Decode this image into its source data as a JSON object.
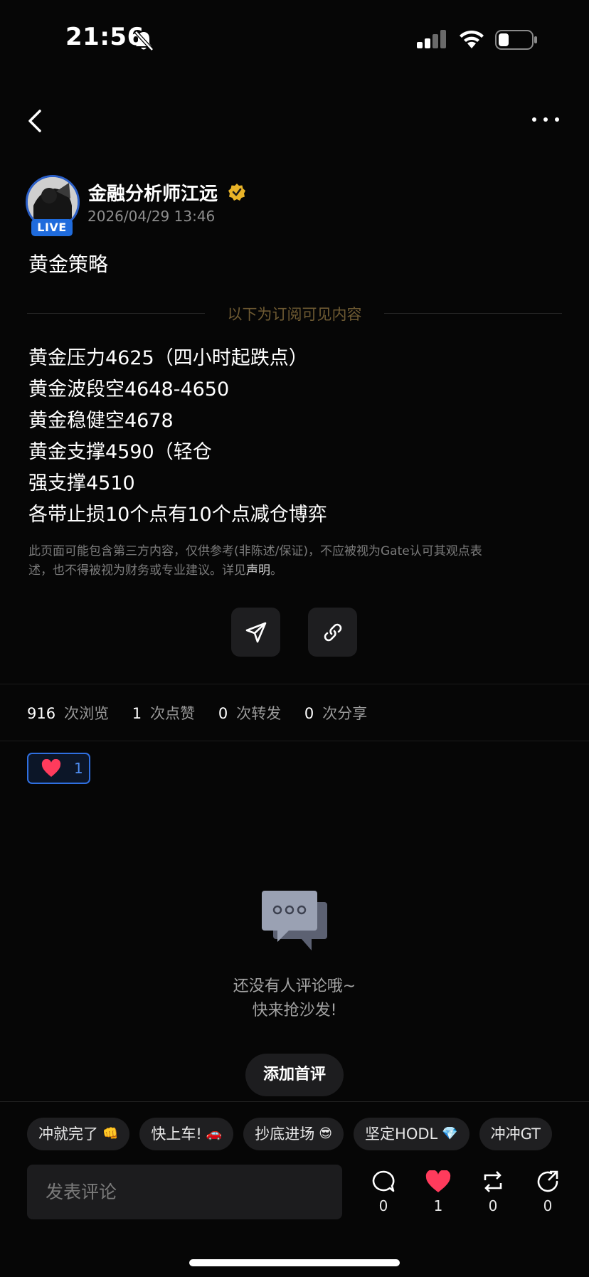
{
  "status_bar": {
    "time": "21:56"
  },
  "post": {
    "author": "金融分析师江远",
    "date": "2026/04/29 13:46",
    "live_badge": "LIVE",
    "title": "黄金策略",
    "subscriber_label": "以下为订阅可见内容",
    "lines": [
      "黄金压力4625（四小时起跌点）",
      "黄金波段空4648-4650",
      "黄金稳健空4678",
      "黄金支撑4590（轻仓",
      "强支撑4510",
      "各带止损10个点有10个点减仓博弈"
    ],
    "disclaimer_line1": "此页面可能包含第三方内容，仅供参考(非陈述/保证)，不应被视为Gate认可其观点表",
    "disclaimer_line2a": "述，也不得被视为财务或专业建议。详见",
    "disclaimer_link": "声明",
    "disclaimer_end": "。"
  },
  "stats": {
    "views": "916",
    "views_label": "次浏览",
    "likes": "1",
    "likes_label": "次点赞",
    "reposts": "0",
    "reposts_label": "次转发",
    "shares": "0",
    "shares_label": "次分享"
  },
  "reaction": {
    "icon": "heart-icon",
    "count": "1"
  },
  "empty_state": {
    "line1": "还没有人评论哦~",
    "line2": "快来抢沙发!",
    "button": "添加首评"
  },
  "quick_replies": [
    {
      "text": "冲就完了",
      "emoji": "👊"
    },
    {
      "text": "快上车!",
      "emoji": "🚗"
    },
    {
      "text": "抄底进场",
      "emoji": "😎"
    },
    {
      "text": "坚定HODL",
      "emoji": "💎"
    },
    {
      "text": "冲冲GT",
      "emoji": ""
    }
  ],
  "comment_bar": {
    "placeholder": "发表评论",
    "comment_count": "0",
    "like_count": "1",
    "repost_count": "0",
    "share_count": "0"
  },
  "colors": {
    "accent_blue": "#2f6fe0",
    "heart_red": "#ff3b5c",
    "subscriber_gold": "#6e5a32"
  }
}
